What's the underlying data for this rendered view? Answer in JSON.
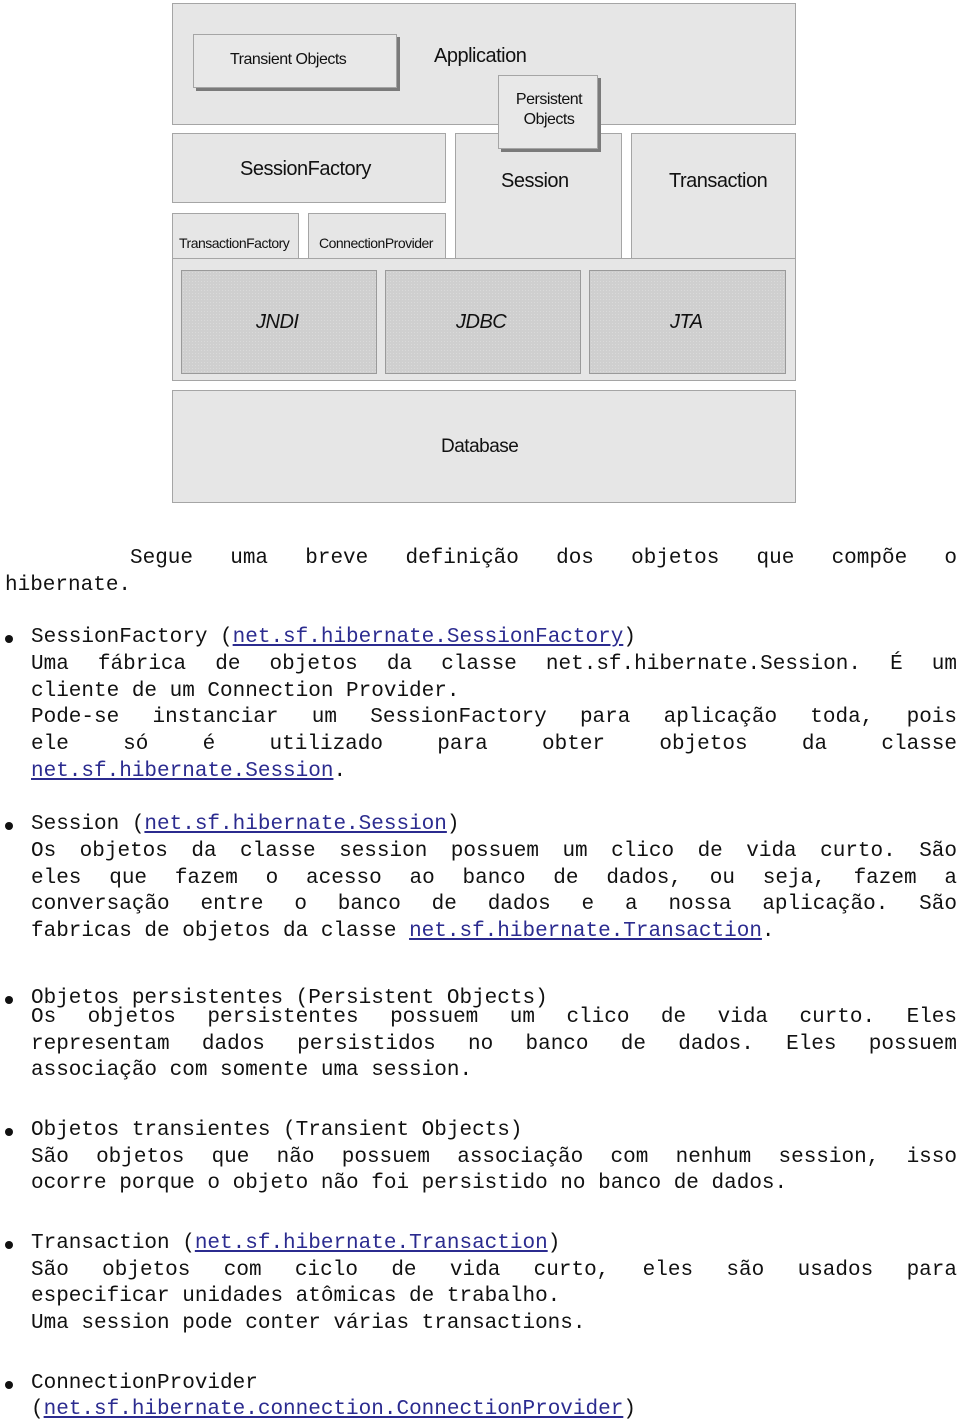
{
  "diagram": {
    "application": "Application",
    "transient_objects": "Transient Objects",
    "persistent_objects_line1": "Persistent",
    "persistent_objects_line2": "Objects",
    "session_factory": "SessionFactory",
    "transaction_factory": "TransactionFactory",
    "connection_provider": "ConnectionProvider",
    "session": "Session",
    "transaction": "Transaction",
    "jndi": "JNDI",
    "jdbc": "JDBC",
    "jta": "JTA",
    "database": "Database"
  },
  "intro": {
    "line1": "Segue uma breve definição dos objetos que compõe o",
    "line2": "hibernate."
  },
  "sections": {
    "session_factory": {
      "title": "SessionFactory (",
      "link": "net.sf.hibernate.SessionFactory",
      "title_end": ")",
      "l1": "Uma fábrica de objetos da classe net.sf.hibernate.Session. É um",
      "l2": "cliente de um Connection Provider.",
      "l3": "Pode-se instanciar um SessionFactory para aplicação toda, pois",
      "l4": "ele só é utilizado para obter objetos da classe",
      "l5_link": "net.sf.hibernate.Session",
      "l5_end": "."
    },
    "session": {
      "title": "Session (",
      "link": "net.sf.hibernate.Session",
      "title_end": ")",
      "l1": "Os objetos da classe session possuem um clico de vida curto. São",
      "l2": "eles que fazem o acesso ao banco de dados, ou seja, fazem a",
      "l3": "conversação entre o banco de dados e a nossa aplicação. São",
      "l4": "fabricas de objetos da classe ",
      "l4_link": "net.sf.hibernate.Transaction",
      "l4_end": "."
    },
    "persistent": {
      "title": "Objetos persistentes (Persistent Objects)",
      "l1": "Os objetos persistentes possuem um clico de vida curto. Eles",
      "l2": "representam dados persistidos no banco de dados. Eles possuem",
      "l3": "associação com somente uma session."
    },
    "transient": {
      "title": "Objetos transientes (Transient Objects)",
      "l1": "São objetos que não possuem associação com nenhum session, isso",
      "l2": "ocorre porque o objeto não foi persistido no banco de dados."
    },
    "transaction": {
      "title": "Transaction (",
      "link": "net.sf.hibernate.Transaction",
      "title_end": ")",
      "l1": "São objetos com ciclo de vida curto, eles são usados para",
      "l2": "especificar unidades atômicas de trabalho.",
      "l3": "Uma session pode conter várias transactions."
    },
    "connection_provider": {
      "title": "ConnectionProvider",
      "l1_start": "(",
      "link": "net.sf.hibernate.connection.ConnectionProvider",
      "l1_end": ")"
    }
  }
}
